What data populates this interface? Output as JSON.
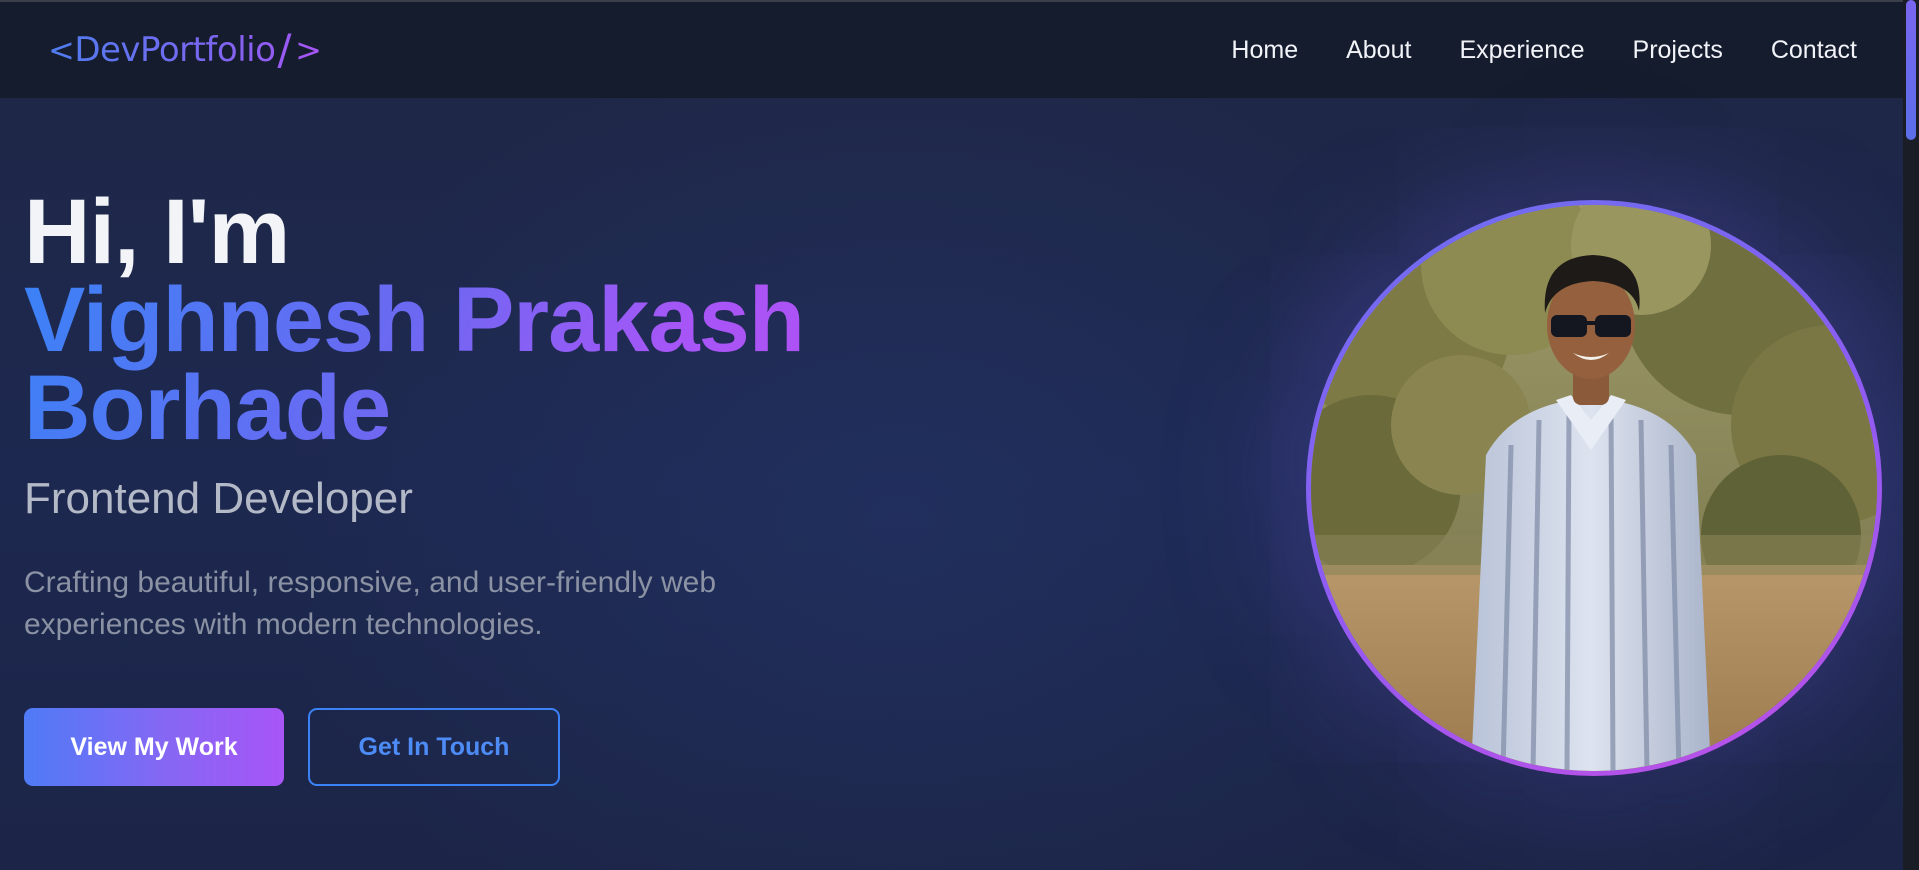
{
  "nav": {
    "logo": {
      "open": "<",
      "text": "DevPortfolio",
      "slash": "/",
      "close": ">"
    },
    "links": [
      "Home",
      "About",
      "Experience",
      "Projects",
      "Contact"
    ]
  },
  "hero": {
    "greeting": "Hi, I'm",
    "name": "Vighnesh Prakash Borhade",
    "role": "Frontend Developer",
    "tagline": "Crafting beautiful, responsive, and user-friendly web experiences with modern technologies.",
    "primary_button": "View My Work",
    "secondary_button": "Get In Touch"
  },
  "colors": {
    "accent_blue": "#3b82f6",
    "accent_purple": "#a855f7",
    "nav_bg": "#151c2d",
    "page_bg": "#1d2850"
  }
}
